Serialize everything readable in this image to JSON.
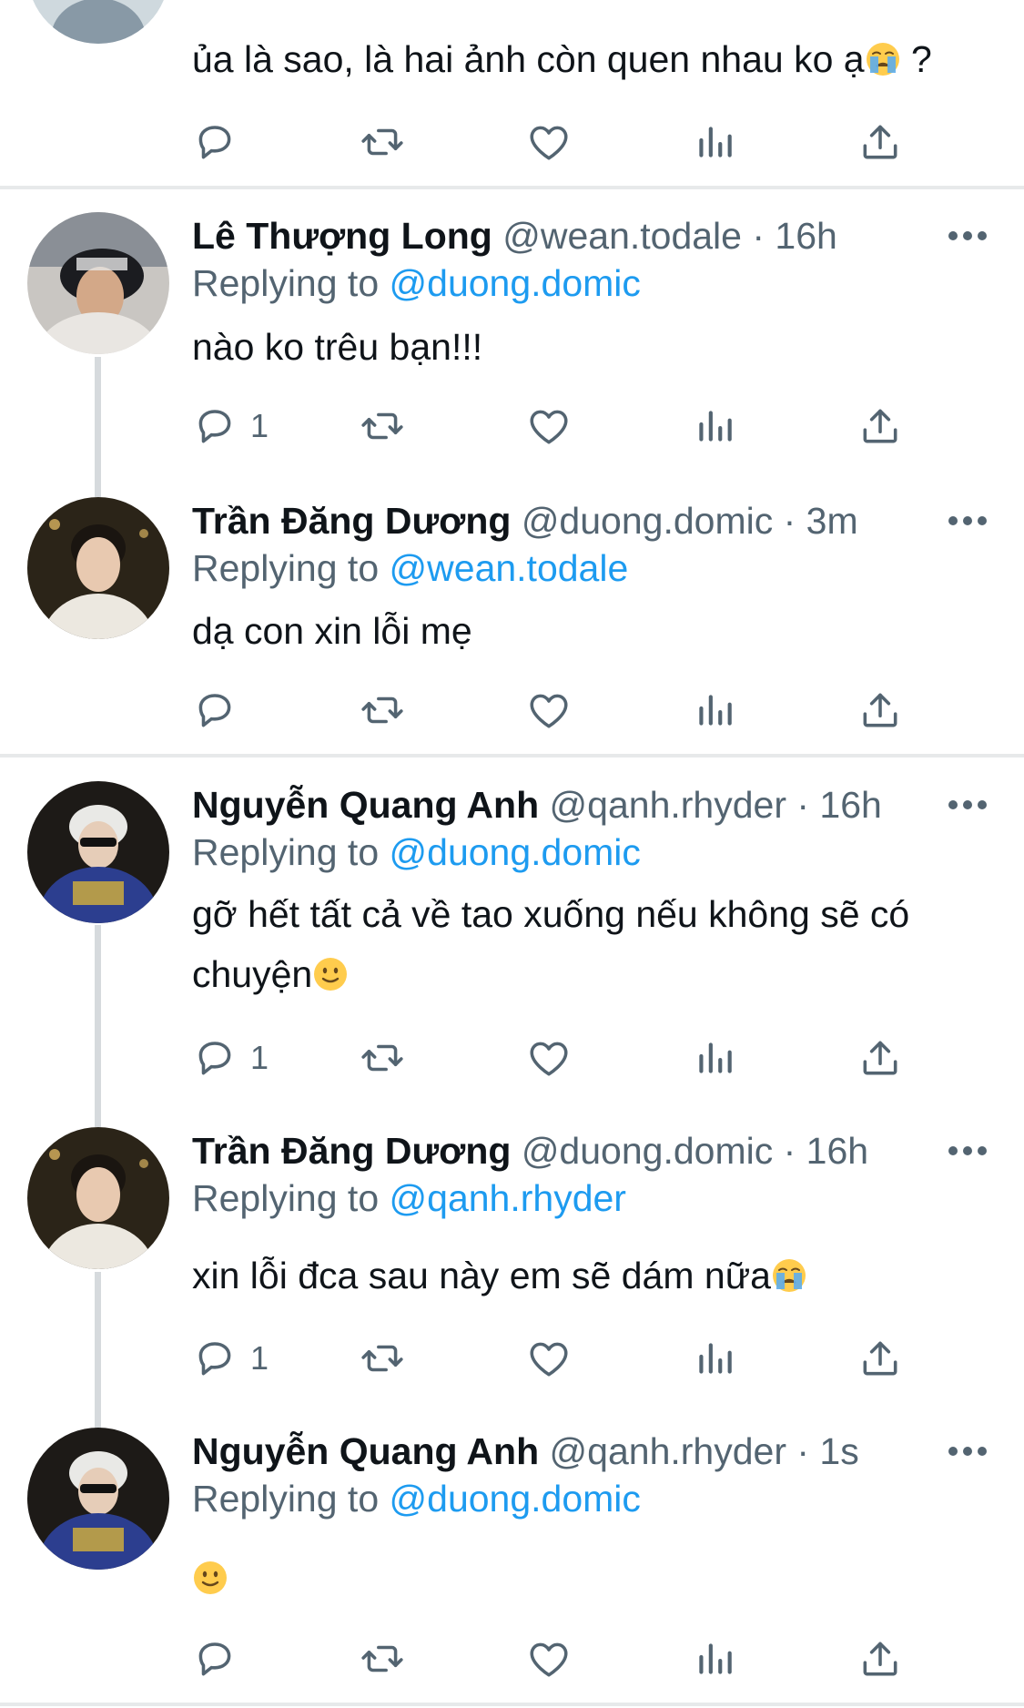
{
  "colors": {
    "accent": "#1d9bf0",
    "secondary_text": "#536471",
    "divider": "#e7e9ea",
    "thread_line": "#d6dadd"
  },
  "icons": {
    "reply": "reply-bubble-icon",
    "retweet": "retweet-icon",
    "like": "heart-icon",
    "views": "bar-chart-icon",
    "share": "share-upload-icon",
    "more": "more-dots-icon"
  },
  "reply_prefix": "Replying to",
  "tweets": [
    {
      "text_before": "ủa là sao, là hai ảnh còn quen nhau ko ạ",
      "emoji": "crying-face-emoji",
      "text_after": " ?",
      "reply_count": ""
    },
    {
      "name": "Lê Thượng Long",
      "handle": "@wean.todale",
      "time": "16h",
      "replying_to": "@duong.domic",
      "text": "nào ko trêu bạn!!!",
      "reply_count": "1"
    },
    {
      "name": "Trần Đăng Dương",
      "handle": "@duong.domic",
      "time": "3m",
      "replying_to": "@wean.todale",
      "text": "dạ con xin lỗi mẹ",
      "reply_count": ""
    },
    {
      "name": "Nguyễn Quang Anh",
      "handle": "@qanh.rhyder",
      "time": "16h",
      "replying_to": "@duong.domic",
      "text_line1": "gỡ hết tất cả về tao xuống nếu không sẽ có",
      "text_line2": "chuyện",
      "emoji": "slightly-smiling-face-emoji",
      "reply_count": "1"
    },
    {
      "name": "Trần Đăng Dương",
      "handle": "@duong.domic",
      "time": "16h",
      "replying_to": "@qanh.rhyder",
      "text": "xin lỗi đca sau này em sẽ dám nữa",
      "emoji": "crying-face-emoji",
      "reply_count": "1"
    },
    {
      "name": "Nguyễn Quang Anh",
      "handle": "@qanh.rhyder",
      "time": "1s",
      "replying_to": "@duong.domic",
      "emoji": "slightly-smiling-face-emoji",
      "reply_count": ""
    }
  ]
}
